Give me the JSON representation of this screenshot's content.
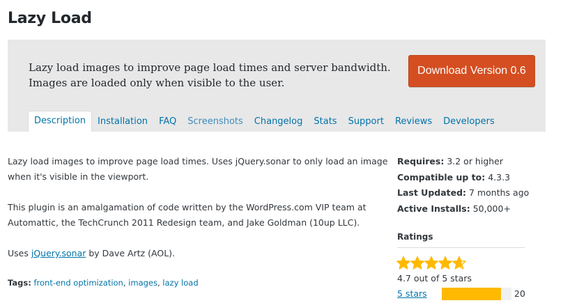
{
  "page": {
    "title": "Lazy Load"
  },
  "banner": {
    "description_lines": [
      "Lazy load images to improve page load times and server bandwidth.",
      "Images are loaded only when visible to the user."
    ],
    "download_label": "Download Version 0.6",
    "colors": {
      "background": "#e8e8e8",
      "download_button": "#d54e21"
    }
  },
  "tabs": [
    {
      "label": "Description",
      "active": true
    },
    {
      "label": "Installation",
      "active": false
    },
    {
      "label": "FAQ",
      "active": false
    },
    {
      "label": "Screenshots",
      "active": false
    },
    {
      "label": "Changelog",
      "active": false
    },
    {
      "label": "Stats",
      "active": false
    },
    {
      "label": "Support",
      "active": false
    },
    {
      "label": "Reviews",
      "active": false
    },
    {
      "label": "Developers",
      "active": false
    }
  ],
  "main": {
    "p1_lines": [
      "Lazy load images to improve page load times. Uses jQuery.sonar to only load an image",
      "when it's visible in the viewport."
    ],
    "p2_lines": [
      "This plugin is an amalgamation of code written by the WordPress.com VIP team at",
      "Automattic, the TechCrunch 2011 Redesign team, and Jake Goldman (10up LLC)."
    ],
    "p3": {
      "prefix": "Uses ",
      "link": "jQuery.sonar",
      "suffix": " by Dave Artz (AOL)."
    },
    "tags": {
      "label": "Tags:",
      "items": [
        "front-end optimization",
        "images",
        "lazy load"
      ]
    }
  },
  "sidebar": {
    "meta": [
      {
        "label": "Requires:",
        "value": "3.2 or higher"
      },
      {
        "label": "Compatible up to:",
        "value": "4.3.3"
      },
      {
        "label": "Last Updated:",
        "value": "7 months ago"
      },
      {
        "label": "Active Installs:",
        "value": "50,000+"
      }
    ],
    "ratings": {
      "heading": "Ratings",
      "stars": 4.7,
      "summary": "4.7 out of 5 stars",
      "rows": [
        {
          "label": "5 stars",
          "count": "20",
          "fraction": 0.85
        }
      ],
      "star_color": "#ffb900"
    }
  }
}
